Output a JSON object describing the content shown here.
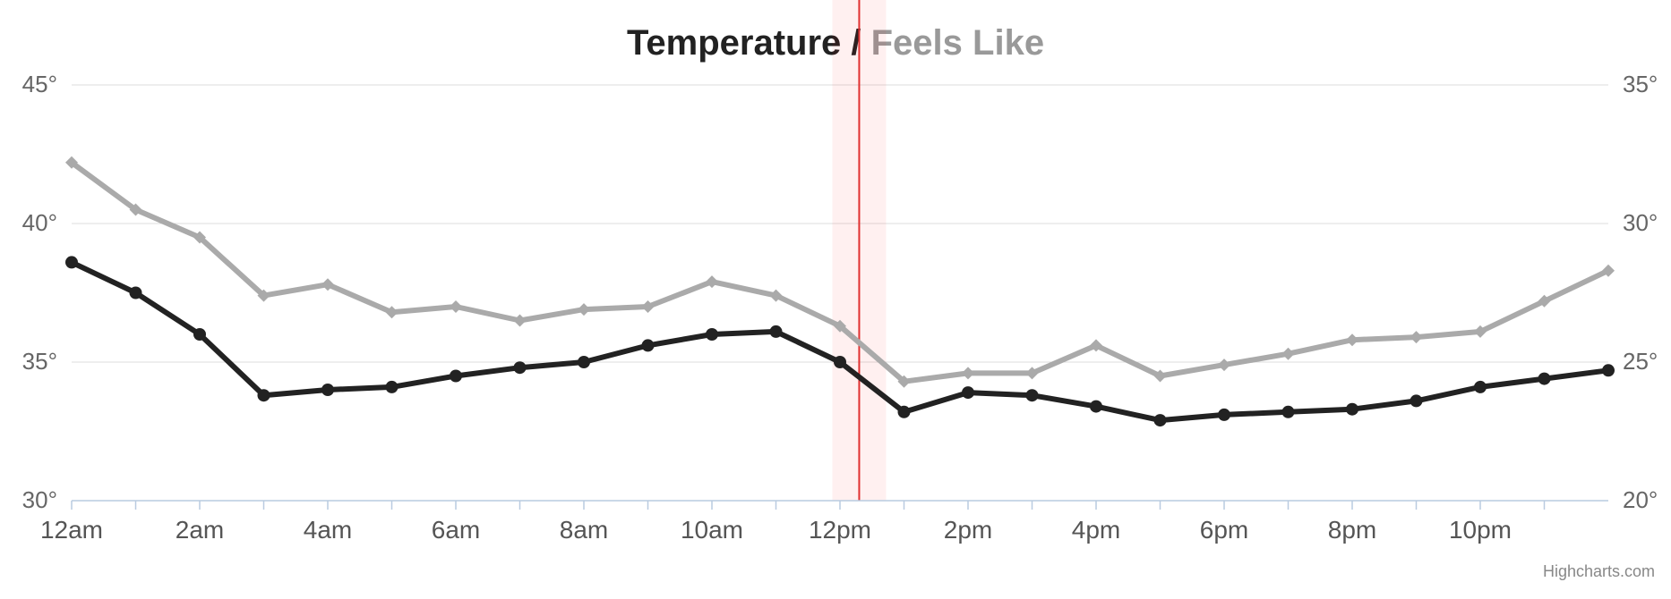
{
  "title": {
    "series1": "Temperature",
    "separator": " / ",
    "series2": "Feels Like"
  },
  "credits": "Highcharts.com",
  "chart_data": {
    "type": "line",
    "xlabel": "",
    "x_tick_labels": [
      "12am",
      "2am",
      "4am",
      "6am",
      "8am",
      "10am",
      "12pm",
      "2pm",
      "4pm",
      "6pm",
      "8pm",
      "10pm"
    ],
    "y_left": {
      "label": "",
      "ticks": [
        30,
        35,
        40,
        45
      ],
      "range": [
        30,
        45
      ],
      "unit": "°",
      "series": "Temperature"
    },
    "y_right": {
      "label": "",
      "ticks": [
        20,
        25,
        30,
        35
      ],
      "range": [
        20,
        35
      ],
      "unit": "°",
      "series": "Feels Like"
    },
    "x_hours": [
      0,
      1,
      2,
      3,
      4,
      5,
      6,
      7,
      8,
      9,
      10,
      11,
      12,
      13,
      14,
      15,
      16,
      17,
      18,
      19,
      20,
      21,
      22,
      23
    ],
    "series": [
      {
        "name": "Temperature",
        "axis": "left",
        "color": "#222222",
        "values": [
          38.6,
          37.5,
          36.0,
          33.8,
          34.0,
          34.1,
          34.5,
          34.8,
          35.0,
          35.6,
          36.0,
          36.1,
          35.0,
          33.2,
          33.9,
          33.8,
          33.4,
          32.9,
          33.1,
          33.2,
          33.3,
          33.6,
          34.1,
          34.4,
          34.7
        ]
      },
      {
        "name": "Feels Like",
        "axis": "right",
        "color": "#aaaaaa",
        "values": [
          32.2,
          30.5,
          29.5,
          27.4,
          27.8,
          26.8,
          27.0,
          26.5,
          26.9,
          27.0,
          27.9,
          27.4,
          26.3,
          24.3,
          24.6,
          24.6,
          25.6,
          24.5,
          24.9,
          25.3,
          25.8,
          25.9,
          26.1,
          27.2,
          28.3
        ]
      }
    ],
    "current_time_index": 12.3
  }
}
